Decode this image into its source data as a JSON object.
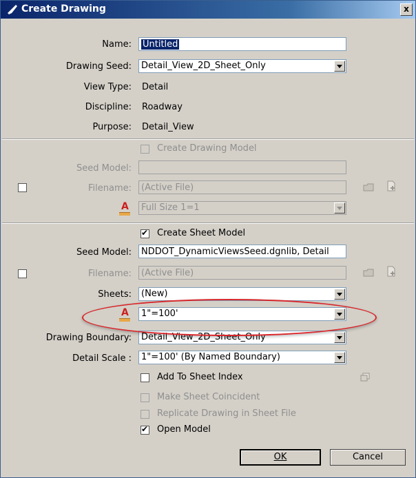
{
  "window": {
    "title": "Create Drawing",
    "close_label": "x"
  },
  "form": {
    "name_label": "Name:",
    "name_value": "Untitled",
    "drawing_seed_label": "Drawing Seed:",
    "drawing_seed_value": "Detail_View_2D_Sheet_Only",
    "view_type_label": "View Type:",
    "view_type_value": "Detail",
    "discipline_label": "Discipline:",
    "discipline_value": "Roadway",
    "purpose_label": "Purpose:",
    "purpose_value": "Detail_View"
  },
  "drawing_model": {
    "create_label": "Create Drawing Model",
    "create_checked": false,
    "seed_model_label": "Seed Model:",
    "seed_model_value": "",
    "filename_label": "Filename:",
    "filename_value": "(Active File)",
    "scale_value": "Full Size 1=1"
  },
  "sheet_model": {
    "create_label": "Create Sheet Model",
    "create_checked": true,
    "seed_model_label": "Seed Model:",
    "seed_model_value": "NDDOT_DynamicViewsSeed.dgnlib, Detail",
    "filename_label": "Filename:",
    "filename_value": "(Active File)",
    "sheets_label": "Sheets:",
    "sheets_value": "(New)",
    "scale_value": "1\"=100'",
    "drawing_boundary_label": "Drawing Boundary:",
    "drawing_boundary_value": "Detail_View_2D_Sheet_Only",
    "detail_scale_label": "Detail Scale :",
    "detail_scale_value": "1\"=100' (By Named Boundary)"
  },
  "options": {
    "add_to_sheet_index": "Add To Sheet Index",
    "make_sheet_coincident": "Make Sheet Coincident",
    "replicate_drawing": "Replicate Drawing in Sheet File",
    "open_model": "Open Model"
  },
  "buttons": {
    "ok_label": "OK",
    "cancel_label": "Cancel"
  },
  "colors": {
    "highlight": "#d9262a",
    "title_bar": "#0a246a",
    "scale_icon": "#cc1e1e"
  }
}
